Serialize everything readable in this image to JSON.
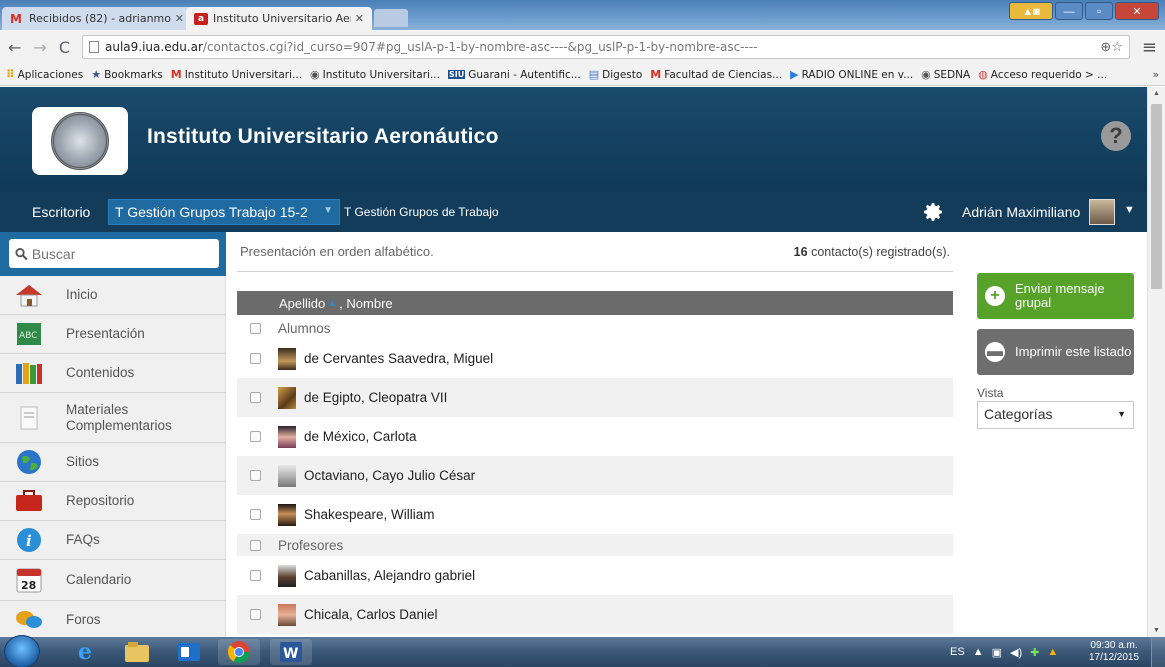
{
  "browser": {
    "tabs": [
      {
        "title": "Recibidos (82) - adrianmo",
        "favicon": "gmail-icon"
      },
      {
        "title": "Instituto Universitario Aero",
        "favicon": "iua-icon"
      }
    ],
    "url_host": "aula9.iua.edu.ar",
    "url_path": "/contactos.cgi?id_curso=907#pg_uslA-p-1-by-nombre-asc----&pg_uslP-p-1-by-nombre-asc----",
    "bookmarks": [
      {
        "label": "Aplicaciones",
        "icon": "apps-icon"
      },
      {
        "label": "Bookmarks",
        "icon": "star-icon"
      },
      {
        "label": "Instituto Universitari...",
        "icon": "gmail-icon"
      },
      {
        "label": "Instituto Universitari...",
        "icon": "seal-icon"
      },
      {
        "label": "Guarani - Autentific...",
        "icon": "siu-icon"
      },
      {
        "label": "Digesto",
        "icon": "doc-icon"
      },
      {
        "label": "Facultad de Ciencias...",
        "icon": "gmail-icon"
      },
      {
        "label": "RADIO ONLINE en v...",
        "icon": "play-icon"
      },
      {
        "label": "SEDNA",
        "icon": "seal-icon"
      },
      {
        "label": "Acceso requerido > ...",
        "icon": "globe-icon"
      }
    ],
    "bookmarks_more": "»"
  },
  "header": {
    "site_title": "Instituto Universitario Aeronáutico",
    "help": "?"
  },
  "navbar": {
    "escritorio": "Escritorio",
    "course_select": "T Gestión Grupos Trabajo 15-2",
    "course_name": "T Gestión Grupos de Trabajo",
    "user_name": "Adrián Maximiliano"
  },
  "sidebar": {
    "search_placeholder": "Buscar",
    "items": [
      {
        "label": "Inicio",
        "icon": "home-icon"
      },
      {
        "label": "Presentación",
        "icon": "abc-icon"
      },
      {
        "label": "Contenidos",
        "icon": "books-icon"
      },
      {
        "label": "Materiales\nComplementarios",
        "icon": "document-icon"
      },
      {
        "label": "Sitios",
        "icon": "globe-icon"
      },
      {
        "label": "Repositorio",
        "icon": "briefcase-icon"
      },
      {
        "label": "FAQs",
        "icon": "info-icon"
      },
      {
        "label": "Calendario",
        "icon": "calendar-icon",
        "day": "28"
      },
      {
        "label": "Foros",
        "icon": "forum-icon"
      }
    ]
  },
  "main": {
    "order_text": "Presentación en orden alfabético.",
    "count": "16",
    "count_suffix": "contacto(s) registrado(s).",
    "col_apellido": "Apellido",
    "col_nombre": ", Nombre",
    "rows": [
      {
        "type": "group",
        "name": "Alumnos"
      },
      {
        "type": "person",
        "name": "de Cervantes Saavedra, Miguel"
      },
      {
        "type": "person",
        "name": "de Egipto, Cleopatra VII"
      },
      {
        "type": "person",
        "name": "de México, Carlota"
      },
      {
        "type": "person",
        "name": "Octaviano, Cayo Julio César"
      },
      {
        "type": "person",
        "name": "Shakespeare, William"
      },
      {
        "type": "group",
        "name": "Profesores"
      },
      {
        "type": "person",
        "name": "Cabanillas, Alejandro gabriel"
      },
      {
        "type": "person",
        "name": "Chicala, Carlos Daniel"
      }
    ]
  },
  "actions": {
    "send_group": "Enviar mensaje grupal",
    "print_list": "Imprimir este listado",
    "vista_label": "Vista",
    "vista_value": "Categorías"
  },
  "taskbar": {
    "lang": "ES",
    "time": "09:30 a.m.",
    "date": "17/12/2015"
  }
}
